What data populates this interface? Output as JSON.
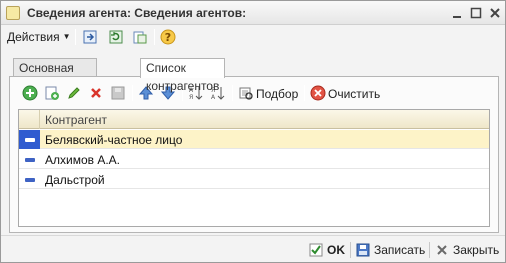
{
  "window": {
    "title": "Сведения агента: Сведения агентов:"
  },
  "toolbar": {
    "actions_label": "Действия"
  },
  "tabs": [
    {
      "label": "Основная информация"
    },
    {
      "label": "Список контрагентов"
    }
  ],
  "inner_toolbar": {
    "select_label": "Подбор",
    "clear_label": "Очистить"
  },
  "grid": {
    "column_header": "Контрагент",
    "rows": [
      {
        "name": "Белявский-частное лицо",
        "selected": true
      },
      {
        "name": "Алхимов А.А.",
        "selected": false
      },
      {
        "name": "Дальстрой",
        "selected": false
      }
    ]
  },
  "footer": {
    "ok_label": "OK",
    "save_label": "Записать",
    "close_label": "Закрыть"
  },
  "colors": {
    "accent": "#2f5bd0",
    "selection": "#fdf3c8",
    "header": "#efe7c9"
  }
}
